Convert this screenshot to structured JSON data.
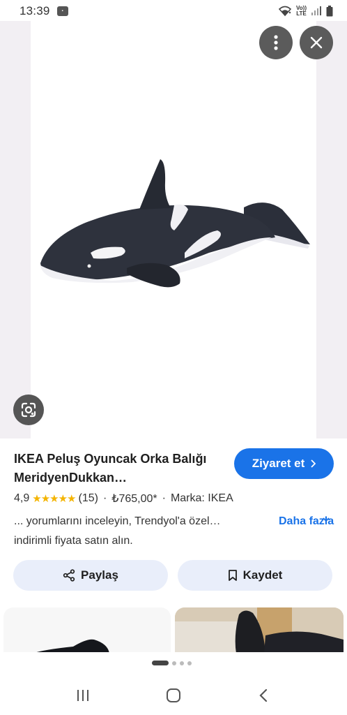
{
  "status_bar": {
    "time": "13:39",
    "app_icon": "app-notification-icon",
    "volte_top": "Vo))",
    "volte_bottom": "LTE",
    "icons": [
      "wifi-icon",
      "volte-icon",
      "signal-icon",
      "battery-icon"
    ]
  },
  "viewer": {
    "image_alt": "orca-plush-image",
    "more_icon": "more-vert-icon",
    "close_icon": "close-icon",
    "lens_icon": "lens-icon"
  },
  "product": {
    "title": "IKEA Peluş Oyuncak Orka Balığı MeridyenDukkan…",
    "visit_label": "Ziyaret et",
    "rating": "4,9",
    "stars": "★★★★★",
    "review_count": "(15)",
    "separator": "·",
    "price": "₺765,00*",
    "brand": "Marka: IKEA",
    "description": "... yorumlarını inceleyin, Trendyol'a özel… indirimli fiyata satın alın.",
    "more_label": "Daha fazla"
  },
  "actions": {
    "share_label": "Paylaş",
    "save_label": "Kaydet"
  },
  "colors": {
    "accent": "#1a73e8",
    "button_bg": "#e9eefa",
    "star": "#f4b400",
    "icon_overlay": "#5b5b5b"
  },
  "pager": {
    "active_index": 0,
    "count": 4
  },
  "navbar": [
    "recents-icon",
    "home-icon",
    "back-icon"
  ]
}
